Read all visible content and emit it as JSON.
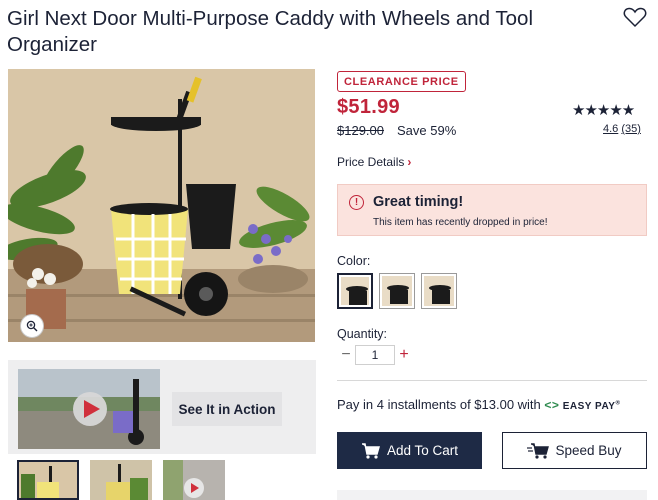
{
  "product": {
    "title": "Girl Next Door Multi-Purpose Caddy with Wheels and Tool Organizer"
  },
  "media": {
    "video_button_label": "See It in Action",
    "thumbnails": [
      "thumb-1",
      "thumb-2",
      "thumb-3"
    ],
    "selected_thumbnail": 0
  },
  "pricing": {
    "badge": "CLEARANCE PRICE",
    "price": "$51.99",
    "original_price": "$129.00",
    "savings": "Save 59%",
    "details_link": "Price Details",
    "details_icon": "chevron-right-icon"
  },
  "rating": {
    "stars_display": "★★★★★",
    "value": 4.6,
    "value_text": "4.6",
    "count_text": "(35)"
  },
  "alert": {
    "icon": "info-icon",
    "icon_glyph": "!",
    "title": "Great timing!",
    "message": "This item has recently dropped in price!"
  },
  "color": {
    "label": "Color:",
    "options_count": 3,
    "selected_index": 0
  },
  "quantity": {
    "label": "Quantity:",
    "value": "1",
    "minus_glyph": "−",
    "plus_glyph": "+"
  },
  "payment": {
    "text": "Pay in 4 installments of $13.00 with",
    "brand_chevrons": "<>",
    "brand": "EASY PAY",
    "trademark": "®"
  },
  "actions": {
    "add_to_cart": "Add To Cart",
    "speed_buy": "Speed Buy"
  },
  "colors": {
    "accent_red": "#c0243a",
    "navy": "#1e2a45",
    "alert_bg": "#fbe3de",
    "easypay_green": "#2d8a4e"
  }
}
